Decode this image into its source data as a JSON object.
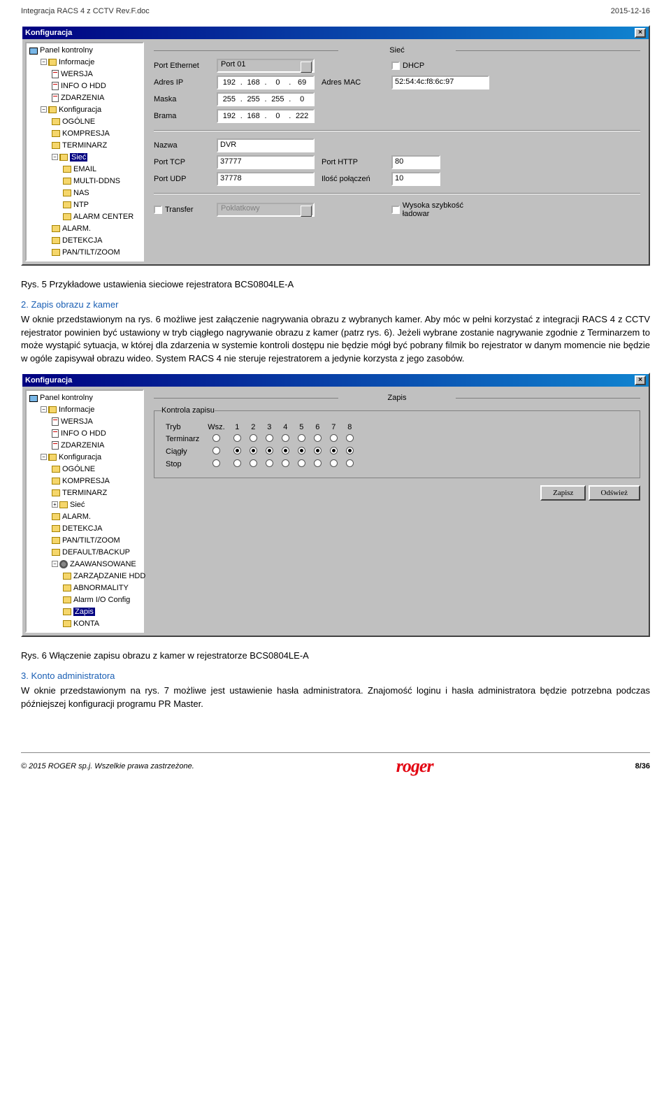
{
  "header": {
    "doc": "Integracja RACS 4 z CCTV Rev.F.doc",
    "date": "2015-12-16"
  },
  "dialog_net": {
    "title": "Konfiguracja",
    "tree": {
      "root": "Panel kontrolny",
      "info": {
        "label": "Informacje",
        "items": [
          "WERSJA",
          "INFO O HDD",
          "ZDARZENIA"
        ]
      },
      "cfg": {
        "label": "Konfiguracja",
        "items": [
          "OGÓLNE",
          "KOMPRESJA",
          "TERMINARZ"
        ],
        "siec": {
          "label": "Sieć",
          "items": [
            "EMAIL",
            "MULTI-DDNS",
            "NAS",
            "NTP",
            "ALARM CENTER"
          ]
        },
        "rest": [
          "ALARM.",
          "DETEKCJA",
          "PAN/TILT/ZOOM"
        ]
      }
    },
    "panel_title": "Sieć",
    "port_eth_l": "Port Ethernet",
    "port_eth_v": "Port 01",
    "dhcp": "DHCP",
    "ip_l": "Adres IP",
    "ip": [
      "192",
      "168",
      "0",
      "69"
    ],
    "mac_l": "Adres MAC",
    "mac": "52:54:4c:f8:6c:97",
    "mask_l": "Maska",
    "mask": [
      "255",
      "255",
      "255",
      "0"
    ],
    "gw_l": "Brama",
    "gw": [
      "192",
      "168",
      "0",
      "222"
    ],
    "name_l": "Nazwa",
    "name": "DVR",
    "tcp_l": "Port TCP",
    "tcp": "37777",
    "http_l": "Port HTTP",
    "http": "80",
    "udp_l": "Port UDP",
    "udp": "37778",
    "conn_l": "Ilość połączeń",
    "conn": "10",
    "transfer": "Transfer",
    "transfer_mode": "Poklatkowy",
    "hispeed": "Wysoka szybkość ładowar"
  },
  "caption1": "Rys. 5 Przykładowe ustawienia sieciowe rejestratora BCS0804LE-A",
  "sec2_title": "2.   Zapis obrazu z kamer",
  "body1": "W oknie przedstawionym na rys. 6 możliwe jest załączenie nagrywania obrazu z wybranych kamer. Aby móc w pełni korzystać z integracji RACS 4 z CCTV rejestrator powinien być ustawiony w tryb ciągłego nagrywanie obrazu z kamer (patrz rys. 6). Jeżeli wybrane zostanie nagrywanie zgodnie z Terminarzem to może wystąpić sytuacja, w której dla zdarzenia w systemie kontroli dostępu nie będzie mógł być pobrany filmik bo rejestrator w danym momencie nie będzie w ogóle zapisywał obrazu wideo. System RACS 4 nie steruje rejestratorem a jedynie korzysta z jego zasobów.",
  "dialog_rec": {
    "title": "Konfiguracja",
    "tree": {
      "root": "Panel kontrolny",
      "info": {
        "label": "Informacje",
        "items": [
          "WERSJA",
          "INFO O HDD",
          "ZDARZENIA"
        ]
      },
      "cfg": {
        "label": "Konfiguracja",
        "items": [
          "OGÓLNE",
          "KOMPRESJA",
          "TERMINARZ",
          "Sieć",
          "ALARM.",
          "DETEKCJA",
          "PAN/TILT/ZOOM",
          "DEFAULT/BACKUP"
        ],
        "adv": {
          "label": "ZAAWANSOWANE",
          "items": [
            "ZARZĄDZANIE HDD",
            "ABNORMALITY",
            "Alarm I/O Config",
            "Zapis",
            "KONTA"
          ]
        }
      }
    },
    "panel_title": "Zapis",
    "group_title": "Kontrola zapisu",
    "rows": [
      "Tryb",
      "Terminarz",
      "Ciągły",
      "Stop"
    ],
    "cols": [
      "Wsz.",
      "1",
      "2",
      "3",
      "4",
      "5",
      "6",
      "7",
      "8"
    ],
    "selected_row": "Ciągły",
    "btn_save": "Zapisz",
    "btn_refresh": "Odśwież"
  },
  "caption2": "Rys. 6 Włączenie zapisu obrazu z kamer w rejestratorze BCS0804LE-A",
  "sec3_title": "3.   Konto administratora",
  "body2": "W oknie przedstawionym na rys. 7 możliwe jest ustawienie hasła administratora. Znajomość loginu i hasła administratora będzie potrzebna podczas późniejszej konfiguracji programu PR Master.",
  "footer": {
    "copy": "© 2015 ROGER sp.j. Wszelkie prawa zastrzeżone.",
    "logo": "roger",
    "page": "8/36"
  }
}
